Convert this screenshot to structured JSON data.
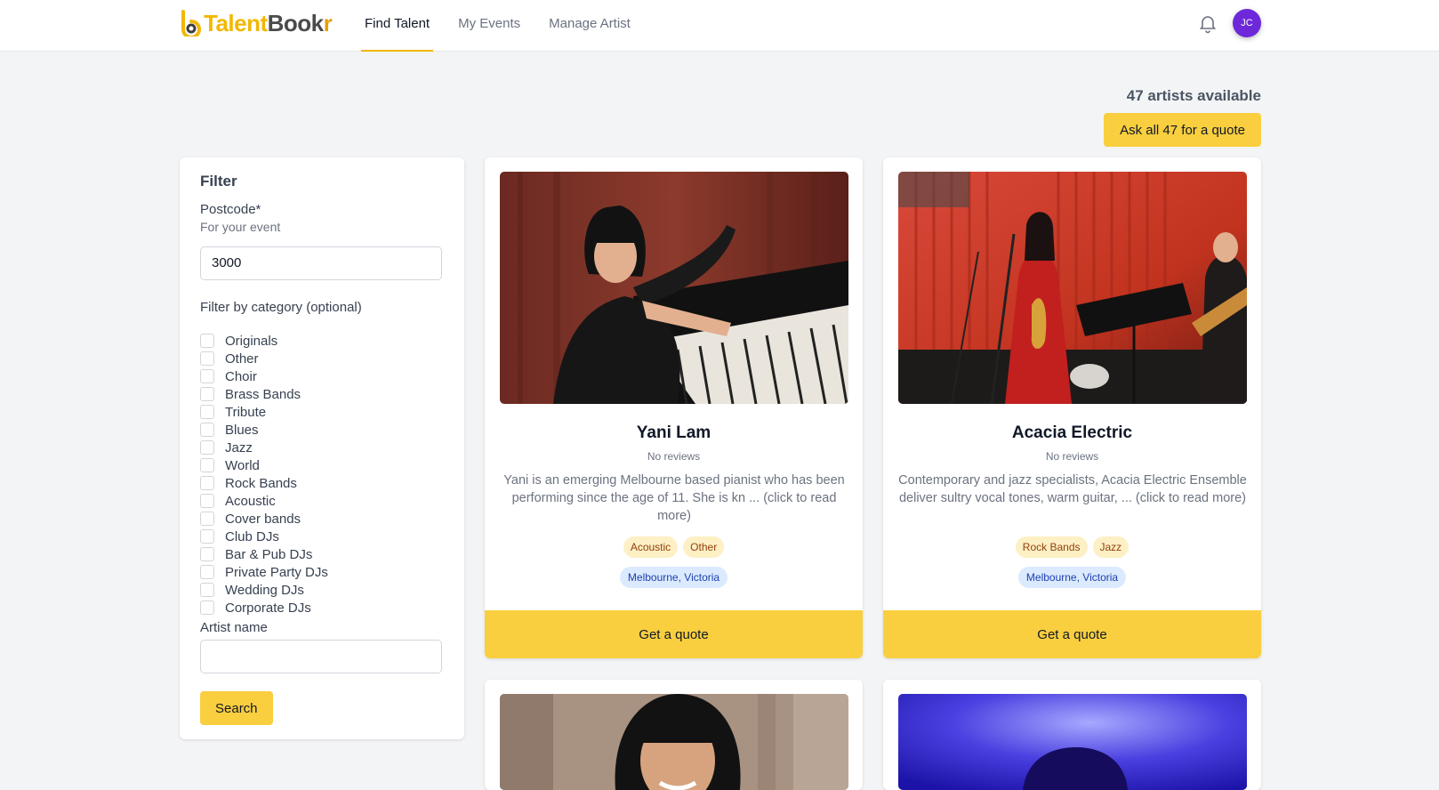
{
  "brand": {
    "name_part1": "Talent",
    "name_part2": "Book",
    "name_part3": "r",
    "accent": "#f9cf3f",
    "icon": "talentbookr-logo-icon"
  },
  "nav": [
    {
      "label": "Find Talent",
      "active": true
    },
    {
      "label": "My Events",
      "active": false
    },
    {
      "label": "Manage Artist",
      "active": false
    }
  ],
  "user": {
    "initials": "JC",
    "avatar_color": "#6d28d9"
  },
  "summary": {
    "available_text": "47 artists available",
    "ask_all_label": "Ask all 47 for a quote"
  },
  "filter": {
    "title": "Filter",
    "postcode_label": "Postcode*",
    "postcode_hint": "For your event",
    "postcode_value": "3000",
    "category_label": "Filter by category (optional)",
    "categories": [
      "Originals",
      "Other",
      "Choir",
      "Brass Bands",
      "Tribute",
      "Blues",
      "Jazz",
      "World",
      "Rock Bands",
      "Acoustic",
      "Cover bands",
      "Club DJs",
      "Bar & Pub DJs",
      "Private Party DJs",
      "Wedding DJs",
      "Corporate DJs"
    ],
    "artist_name_label": "Artist name",
    "artist_name_value": "",
    "search_label": "Search"
  },
  "artists": [
    {
      "name": "Yani Lam",
      "reviews": "No reviews",
      "description": "Yani is an emerging Melbourne based pianist who has been performing since the age of 11. She is kn ... (click to read more)",
      "tags": [
        "Acoustic",
        "Other"
      ],
      "location": "Melbourne, Victoria",
      "quote_label": "Get a quote"
    },
    {
      "name": "Acacia Electric",
      "reviews": "No reviews",
      "description": "Contemporary and jazz specialists, Acacia Electric Ensemble deliver sultry vocal tones, warm guitar, ... (click to read more)",
      "tags": [
        "Rock Bands",
        "Jazz"
      ],
      "location": "Melbourne, Victoria",
      "quote_label": "Get a quote"
    }
  ]
}
